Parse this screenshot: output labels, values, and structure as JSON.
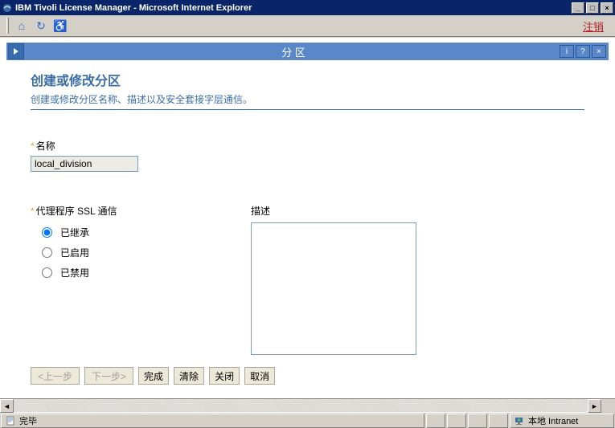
{
  "window": {
    "title": "IBM Tivoli License Manager - Microsoft Internet Explorer",
    "min_label": "_",
    "max_label": "□",
    "close_label": "×"
  },
  "toolbar": {
    "home_icon": "⌂",
    "refresh_icon": "↻",
    "access_icon": "♿",
    "logout_link": "注销"
  },
  "section": {
    "toggle_icon": "▸",
    "title": "分 区",
    "info_label": "i",
    "help_label": "?",
    "close_label": "×"
  },
  "page": {
    "title": "创建或修改分区",
    "subtitle": "创建或修改分区名称、描述以及安全套接字层通信。"
  },
  "form": {
    "name_label": "名称",
    "name_value": "local_division",
    "ssl_label": "代理程序 SSL 通信",
    "radio_inherit": "已继承",
    "radio_enabled": "已启用",
    "radio_disabled": "已禁用",
    "radio_selected": "inherit",
    "desc_label": "描述",
    "desc_value": ""
  },
  "buttons": {
    "prev": "<上一步",
    "next": "下一步>",
    "finish": "完成",
    "clear": "清除",
    "close": "关闭",
    "cancel": "取消"
  },
  "status": {
    "done": "完毕",
    "zone": "本地 Intranet"
  }
}
